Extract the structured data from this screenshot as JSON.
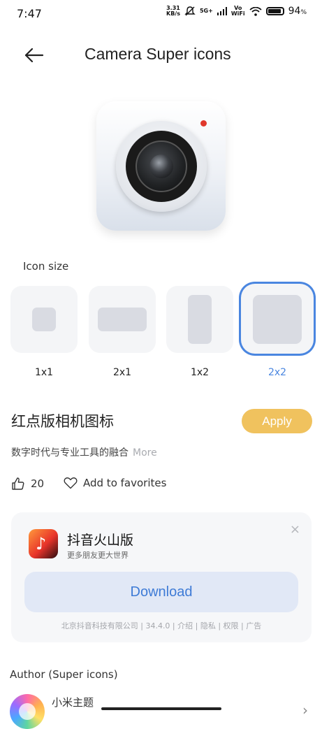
{
  "status_bar": {
    "time": "7:47",
    "network_speed": "3.31\nKB/s",
    "network_type": "5G+",
    "volte": "Vo\nWiFi",
    "battery": "94",
    "battery_unit": "%"
  },
  "header": {
    "title": "Camera Super icons"
  },
  "icon_size": {
    "label": "Icon size",
    "options": [
      {
        "label": "1x1",
        "selected": false
      },
      {
        "label": "2x1",
        "selected": false
      },
      {
        "label": "1x2",
        "selected": false
      },
      {
        "label": "2x2",
        "selected": true
      }
    ]
  },
  "theme": {
    "title": "红点版相机图标",
    "apply_label": "Apply",
    "description": "数字时代与专业工具的融合",
    "more_label": "More",
    "likes": "20",
    "favorite_label": "Add to favorites"
  },
  "ad": {
    "app_name": "抖音火山版",
    "subtitle": "更多朋友更大世界",
    "download_label": "Download",
    "meta": "北京抖音科技有限公司 | 34.4.0 | 介绍 | 隐私 | 权限 | 广告",
    "close_symbol": "×"
  },
  "author": {
    "label": "Author (Super icons)",
    "name": "小米主题"
  },
  "colors": {
    "accent_blue": "#4a86e0",
    "apply_yellow": "#f0c25e",
    "camera_dot_red": "#e0382c"
  }
}
